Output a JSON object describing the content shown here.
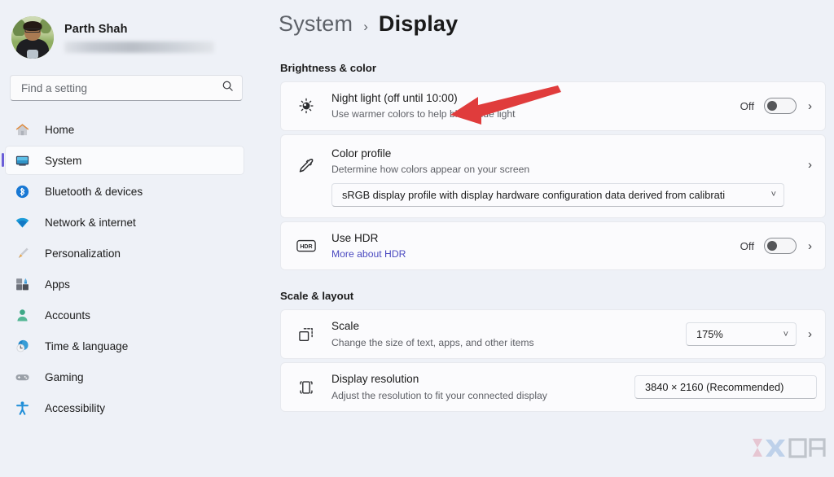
{
  "sidebar": {
    "profile": {
      "name": "Parth Shah",
      "email_redacted": true
    },
    "search": {
      "placeholder": "Find a setting",
      "value": "",
      "icon": "search-icon"
    },
    "items": [
      {
        "label": "Home",
        "icon": "home-icon",
        "selected": false
      },
      {
        "label": "System",
        "icon": "monitor-icon",
        "selected": true
      },
      {
        "label": "Bluetooth & devices",
        "icon": "bluetooth-icon",
        "selected": false
      },
      {
        "label": "Network & internet",
        "icon": "wifi-icon",
        "selected": false
      },
      {
        "label": "Personalization",
        "icon": "paintbrush-icon",
        "selected": false
      },
      {
        "label": "Apps",
        "icon": "apps-icon",
        "selected": false
      },
      {
        "label": "Accounts",
        "icon": "person-icon",
        "selected": false
      },
      {
        "label": "Time & language",
        "icon": "clock-globe-icon",
        "selected": false
      },
      {
        "label": "Gaming",
        "icon": "gamepad-icon",
        "selected": false
      },
      {
        "label": "Accessibility",
        "icon": "accessibility-icon",
        "selected": false
      }
    ]
  },
  "header": {
    "breadcrumb_parent": "System",
    "breadcrumb_separator": "›",
    "breadcrumb_current": "Display"
  },
  "sections": [
    {
      "title": "Brightness & color"
    },
    {
      "title": "Scale & layout"
    }
  ],
  "cards": {
    "night_light": {
      "title": "Night light (off until 10:00)",
      "subtitle": "Use warmer colors to help block blue light",
      "icon": "night-light-sun-icon",
      "toggle_label": "Off",
      "toggle_state": "off",
      "chevron": "›"
    },
    "color_profile": {
      "title": "Color profile",
      "subtitle": "Determine how colors appear on your screen",
      "icon": "eyedropper-icon",
      "dropdown_value": "sRGB display profile with display hardware configuration data derived from calibrati",
      "chevron": "›"
    },
    "hdr": {
      "title": "Use HDR",
      "link": "More about HDR",
      "icon": "hdr-badge-icon",
      "toggle_label": "Off",
      "toggle_state": "off",
      "chevron": "›"
    },
    "scale": {
      "title": "Scale",
      "subtitle": "Change the size of text, apps, and other items",
      "icon": "scale-squares-icon",
      "dropdown_value": "175%",
      "chevron": "›"
    },
    "display_resolution": {
      "title": "Display resolution",
      "subtitle": "Adjust the resolution to fit your connected display",
      "icon": "display-resolution-icon",
      "dropdown_value": "3840 × 2160 (Recommended)"
    }
  },
  "annotation": {
    "type": "arrow",
    "color": "#e03c3c",
    "points_to": "night-light-title"
  },
  "colors": {
    "background": "#eef1f7",
    "card": "#fbfbfd",
    "accent_selected": "#6b5ed8",
    "link": "#4b4ac0",
    "annotation_red": "#e03c3c"
  }
}
